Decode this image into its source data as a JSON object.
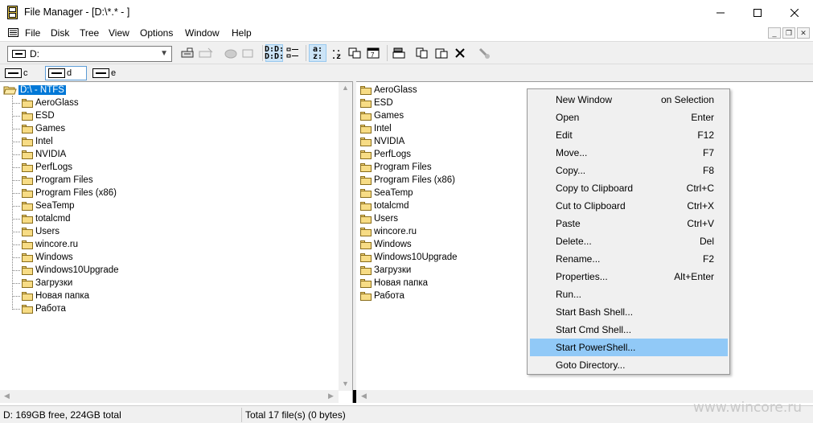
{
  "window": {
    "title": "File Manager - [D:\\*.* - ]"
  },
  "menu": [
    "File",
    "Disk",
    "Tree",
    "View",
    "Options",
    "Window",
    "Help"
  ],
  "toolbar": {
    "drive_value": "D:"
  },
  "drives": [
    {
      "label": "c"
    },
    {
      "label": "d",
      "active": true
    },
    {
      "label": "e"
    }
  ],
  "tree": {
    "root": "D:\\ - NTFS",
    "folders": [
      "AeroGlass",
      "ESD",
      "Games",
      "Intel",
      "NVIDIA",
      "PerfLogs",
      "Program Files",
      "Program Files (x86)",
      "SeaTemp",
      "totalcmd",
      "Users",
      "wincore.ru",
      "Windows",
      "Windows10Upgrade",
      "Загрузки",
      "Новая папка",
      "Работа"
    ]
  },
  "files": [
    "AeroGlass",
    "ESD",
    "Games",
    "Intel",
    "NVIDIA",
    "PerfLogs",
    "Program Files",
    "Program Files (x86)",
    "SeaTemp",
    "totalcmd",
    "Users",
    "wincore.ru",
    "Windows",
    "Windows10Upgrade",
    "Загрузки",
    "Новая папка",
    "Работа"
  ],
  "context_menu": [
    {
      "label": "New Window",
      "key": "on Selection"
    },
    {
      "label": "Open",
      "key": "Enter"
    },
    {
      "label": "Edit",
      "key": "F12"
    },
    {
      "label": "Move...",
      "key": "F7"
    },
    {
      "label": "Copy...",
      "key": "F8"
    },
    {
      "label": "Copy to Clipboard",
      "key": "Ctrl+C"
    },
    {
      "label": "Cut to Clipboard",
      "key": "Ctrl+X"
    },
    {
      "label": "Paste",
      "key": "Ctrl+V"
    },
    {
      "label": "Delete...",
      "key": "Del"
    },
    {
      "label": "Rename...",
      "key": "F2"
    },
    {
      "label": "Properties...",
      "key": "Alt+Enter"
    },
    {
      "label": "Run...",
      "key": ""
    },
    {
      "label": "Start Bash Shell...",
      "key": ""
    },
    {
      "label": "Start Cmd Shell...",
      "key": ""
    },
    {
      "label": "Start PowerShell...",
      "key": "",
      "highlighted": true
    },
    {
      "label": "Goto Directory...",
      "key": ""
    }
  ],
  "status": {
    "left": "D: 169GB free,  224GB total",
    "right": "Total 17 file(s) (0 bytes)"
  },
  "watermark": "www.wincore.ru",
  "colors": {
    "selection": "#0078d7",
    "menu_highlight": "#91c9f7",
    "folder": "#f7dc85"
  }
}
